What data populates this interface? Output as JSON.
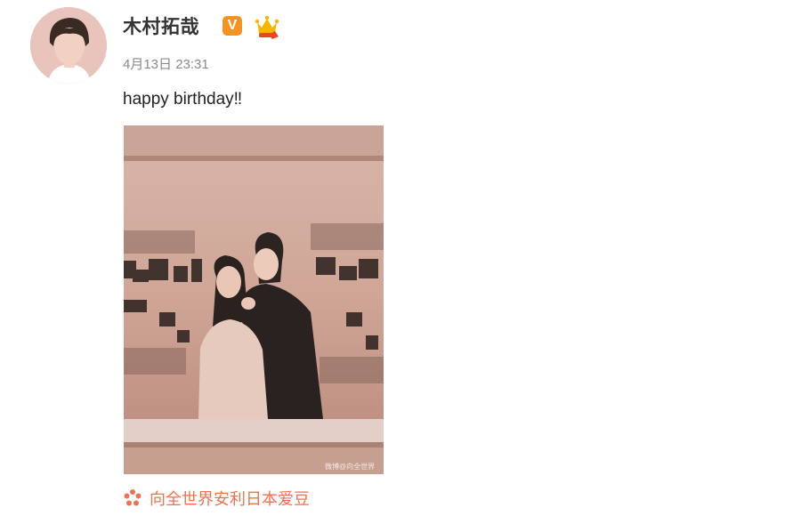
{
  "post": {
    "username": "木村拓哉",
    "verified_badge": "V",
    "timestamp": "4月13日 23:31",
    "text": "happy birthday‼︎",
    "photo_watermark": "微博@向全世界",
    "location_label": "向全世界安利日本爱豆"
  },
  "icons": {
    "avatar": "user-avatar",
    "verified": "verified-v-icon",
    "member": "crown-member-icon",
    "location": "flower-location-icon"
  },
  "colors": {
    "username": "#333333",
    "timestamp": "#8a8a8a",
    "verified": "#f29322",
    "location": "#eb7350"
  }
}
